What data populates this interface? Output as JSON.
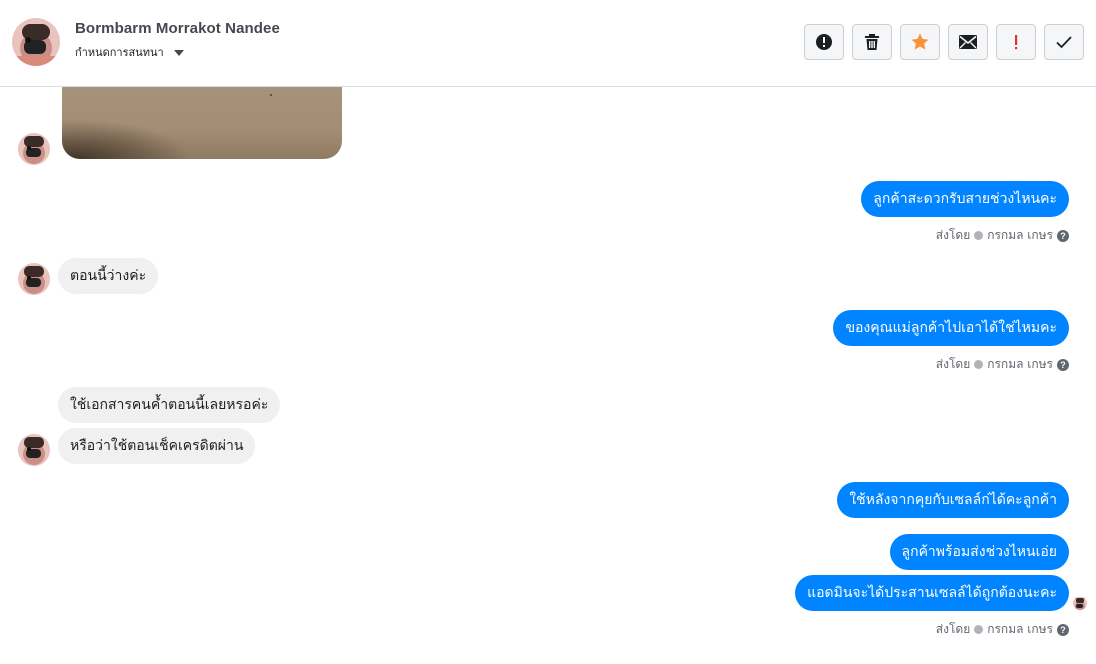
{
  "header": {
    "contact_name": "Bormbarm Morrakot Nandee",
    "conversation_label": "กำหนดการสนทนา"
  },
  "toolbar": {
    "buttons": [
      {
        "icon": "alert-circle-icon"
      },
      {
        "icon": "trash-icon"
      },
      {
        "icon": "star-icon",
        "color": "#f7923a"
      },
      {
        "icon": "envelope-icon"
      },
      {
        "icon": "exclamation-icon",
        "color": "#e0352b"
      },
      {
        "icon": "checkmark-icon"
      }
    ]
  },
  "messages": [
    {
      "direction": "incoming",
      "type": "photo"
    },
    {
      "direction": "outgoing",
      "text": "ลูกค้าสะดวกรับสายช่วงไหนคะ"
    },
    {
      "direction": "incoming",
      "text": "ตอนนี้ว่างค่ะ"
    },
    {
      "direction": "outgoing",
      "text": "ของคุณแม่ลูกค้าไปเอาได้ใช่ไหมคะ"
    },
    {
      "direction": "incoming",
      "text": "ใช้เอกสารคนค้ำตอนนี้เลยหรอค่ะ"
    },
    {
      "direction": "incoming",
      "text": "หรือว่าใช้ตอนเช็คเครดิตผ่าน"
    },
    {
      "direction": "outgoing",
      "text": "ใช้หลังจากคุยกับเซลล์ก่ได้คะลูกค้า"
    },
    {
      "direction": "outgoing",
      "text": "ลูกค้าพร้อมส่งช่วงไหนเอ่ย"
    },
    {
      "direction": "outgoing",
      "text": "แอดมินจะได้ประสานเซลล์ได้ถูกต้องนะคะ"
    }
  ],
  "sent_by": {
    "prefix": "ส่งโดย",
    "name": "กรกมล เกษร",
    "help": "?"
  },
  "colors": {
    "outgoing_bubble": "#0084ff",
    "incoming_bubble": "#f1f0f0",
    "header_border": "#dadde1"
  }
}
